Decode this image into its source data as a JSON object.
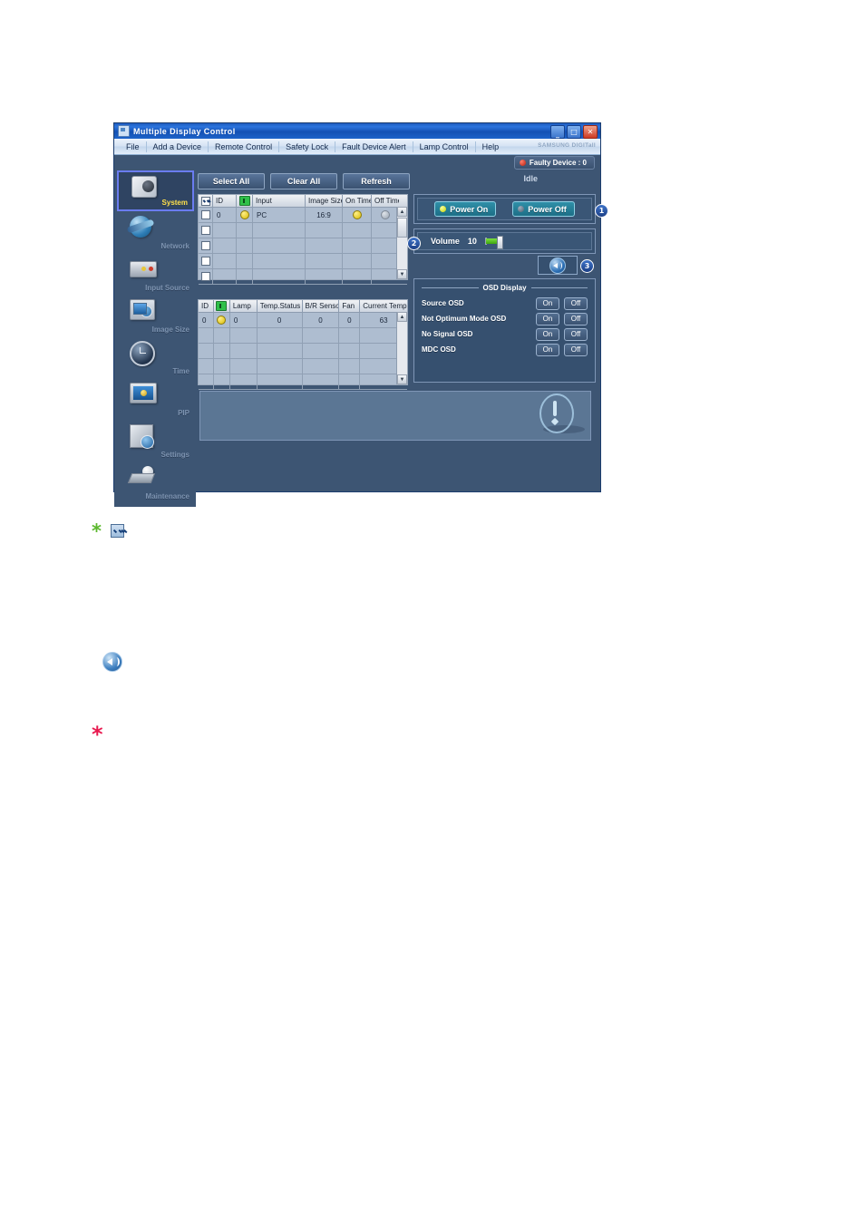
{
  "window": {
    "title": "Multiple Display Control",
    "title_icon": "app-window-icon",
    "controls": {
      "minimize": "_",
      "maximize": "□",
      "close": "✕"
    }
  },
  "menu": {
    "items": [
      {
        "label": "File"
      },
      {
        "label": "Add a Device"
      },
      {
        "label": "Remote Control"
      },
      {
        "label": "Safety Lock"
      },
      {
        "label": "Fault Device Alert"
      },
      {
        "label": "Lamp Control"
      },
      {
        "label": "Help"
      }
    ],
    "brand": "SAMSUNG DIGITall"
  },
  "status": {
    "faulty_device": "Faulty Device : 0",
    "idle": "Idle"
  },
  "sidebar": {
    "items": [
      {
        "label": "System",
        "icon": "system-camera-icon",
        "selected": true
      },
      {
        "label": "Network",
        "icon": "network-globe-icon",
        "selected": false
      },
      {
        "label": "Input Source",
        "icon": "input-source-box-icon",
        "selected": false
      },
      {
        "label": "Image Size",
        "icon": "image-size-monitor-icon",
        "selected": false
      },
      {
        "label": "Time",
        "icon": "time-clock-icon",
        "selected": false
      },
      {
        "label": "PIP",
        "icon": "pip-monitor-icon",
        "selected": false
      },
      {
        "label": "Settings",
        "icon": "settings-cube-icon",
        "selected": false
      },
      {
        "label": "Maintenance",
        "icon": "maintenance-tool-icon",
        "selected": false
      }
    ]
  },
  "toolbar": {
    "select_all": "Select All",
    "clear_all": "Clear All",
    "refresh": "Refresh"
  },
  "device_table": {
    "headers": [
      "",
      "ID",
      "power-icon",
      "Input",
      "Image Size",
      "On Time",
      "Off Time"
    ],
    "rows": [
      {
        "checked": false,
        "id": "0",
        "power": "yellow",
        "input": "PC",
        "image_size": "16:9",
        "on_time": "yellow",
        "off_time": "gray"
      },
      {
        "checked": false,
        "id": "",
        "power": "",
        "input": "",
        "image_size": "",
        "on_time": "",
        "off_time": ""
      },
      {
        "checked": false,
        "id": "",
        "power": "",
        "input": "",
        "image_size": "",
        "on_time": "",
        "off_time": ""
      },
      {
        "checked": false,
        "id": "",
        "power": "",
        "input": "",
        "image_size": "",
        "on_time": "",
        "off_time": ""
      },
      {
        "checked": false,
        "id": "",
        "power": "",
        "input": "",
        "image_size": "",
        "on_time": "",
        "off_time": ""
      }
    ]
  },
  "lamp_table": {
    "headers": [
      "ID",
      "power-icon",
      "Lamp",
      "Temp.Status",
      "B/R Sensor",
      "Fan",
      "Current Temp."
    ],
    "rows": [
      {
        "id": "0",
        "power": "yellow",
        "lamp": "0",
        "temp_status": "0",
        "br_sensor": "0",
        "fan": "0",
        "current_temp": "63"
      },
      {
        "id": "",
        "power": "",
        "lamp": "",
        "temp_status": "",
        "br_sensor": "",
        "fan": "",
        "current_temp": ""
      },
      {
        "id": "",
        "power": "",
        "lamp": "",
        "temp_status": "",
        "br_sensor": "",
        "fan": "",
        "current_temp": ""
      },
      {
        "id": "",
        "power": "",
        "lamp": "",
        "temp_status": "",
        "br_sensor": "",
        "fan": "",
        "current_temp": ""
      },
      {
        "id": "",
        "power": "",
        "lamp": "",
        "temp_status": "",
        "br_sensor": "",
        "fan": "",
        "current_temp": ""
      }
    ]
  },
  "power": {
    "on_label": "Power On",
    "off_label": "Power Off",
    "callout": "1"
  },
  "volume": {
    "label": "Volume",
    "value": "10",
    "percent": 10,
    "callout": "2"
  },
  "mute": {
    "icon": "speaker-mute-icon",
    "callout": "3"
  },
  "osd": {
    "title": "OSD Display",
    "on_label": "On",
    "off_label": "Off",
    "rows": [
      {
        "label": "Source OSD"
      },
      {
        "label": "Not Optimum Mode OSD"
      },
      {
        "label": "No Signal OSD"
      },
      {
        "label": "MDC OSD"
      }
    ]
  },
  "message_panel": {
    "icon": "exclamation-mark-icon",
    "text": ""
  },
  "annotations": {
    "green_asterisk": "*",
    "green_asterisk_color": "#5cb82e",
    "checkbox_icon": "checked-checkbox-icon",
    "speaker_icon": "speaker-mute-icon",
    "red_asterisk": "*",
    "red_asterisk_color": "#e8194f"
  },
  "colors": {
    "window_bg": "#3d5573",
    "titlebar": "#1d63c9",
    "panel_bg": "#36506f",
    "table_bg": "#aebdd0",
    "accent_yellow": "#ffe14d",
    "teal_button": "#2f8fa8"
  }
}
